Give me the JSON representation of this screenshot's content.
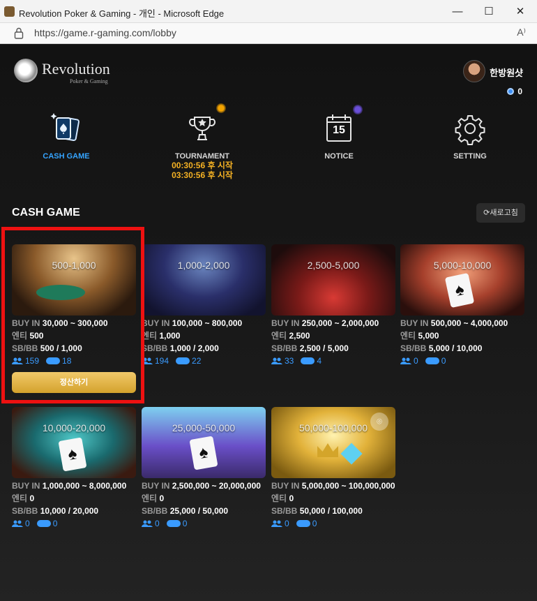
{
  "browser": {
    "title": "Revolution Poker & Gaming - 개인 - Microsoft Edge",
    "url": "https://game.r-gaming.com/lobby",
    "read_aloud": "A⁾"
  },
  "brand": {
    "name": "Revolution",
    "tagline": "Poker & Gaming"
  },
  "user": {
    "name": "한방원샷",
    "coins": "0"
  },
  "nav": {
    "cash_game": "CASH GAME",
    "tournament": "TOURNAMENT",
    "tournament_timers": [
      "00:30:56 후 시작",
      "03:30:56 후 시작"
    ],
    "notice": "NOTICE",
    "notice_date": "15",
    "setting": "SETTING"
  },
  "section": {
    "title": "CASH GAME",
    "refresh_label": "새로고침"
  },
  "labels": {
    "buy_in": "BUY IN",
    "ante": "엔티",
    "sbbb": "SB/BB",
    "settle": "정산하기"
  },
  "tables": [
    {
      "stakes": "500-1,000",
      "buy_in": "30,000 ~ 300,000",
      "ante": "500",
      "sbbb": "500 / 1,000",
      "players": "159",
      "tables": "18"
    },
    {
      "stakes": "1,000-2,000",
      "buy_in": "100,000 ~ 800,000",
      "ante": "1,000",
      "sbbb": "1,000 / 2,000",
      "players": "194",
      "tables": "22"
    },
    {
      "stakes": "2,500-5,000",
      "buy_in": "250,000 ~ 2,000,000",
      "ante": "2,500",
      "sbbb": "2,500 / 5,000",
      "players": "33",
      "tables": "4"
    },
    {
      "stakes": "5,000-10,000",
      "buy_in": "500,000 ~ 4,000,000",
      "ante": "5,000",
      "sbbb": "5,000 / 10,000",
      "players": "0",
      "tables": "0"
    },
    {
      "stakes": "10,000-20,000",
      "buy_in": "1,000,000 ~ 8,000,000",
      "ante": "0",
      "sbbb": "10,000 / 20,000",
      "players": "0",
      "tables": "0"
    },
    {
      "stakes": "25,000-50,000",
      "buy_in": "2,500,000 ~ 20,000,000",
      "ante": "0",
      "sbbb": "25,000 / 50,000",
      "players": "0",
      "tables": "0"
    },
    {
      "stakes": "50,000-100,000",
      "buy_in": "5,000,000 ~ 100,000,000",
      "ante": "0",
      "sbbb": "50,000 / 100,000",
      "players": "0",
      "tables": "0"
    }
  ],
  "colors": {
    "accent_blue": "#35a4ff",
    "timer_orange": "#f5b224",
    "highlight_red": "#ee1111",
    "gold_button": "#e0b040"
  }
}
